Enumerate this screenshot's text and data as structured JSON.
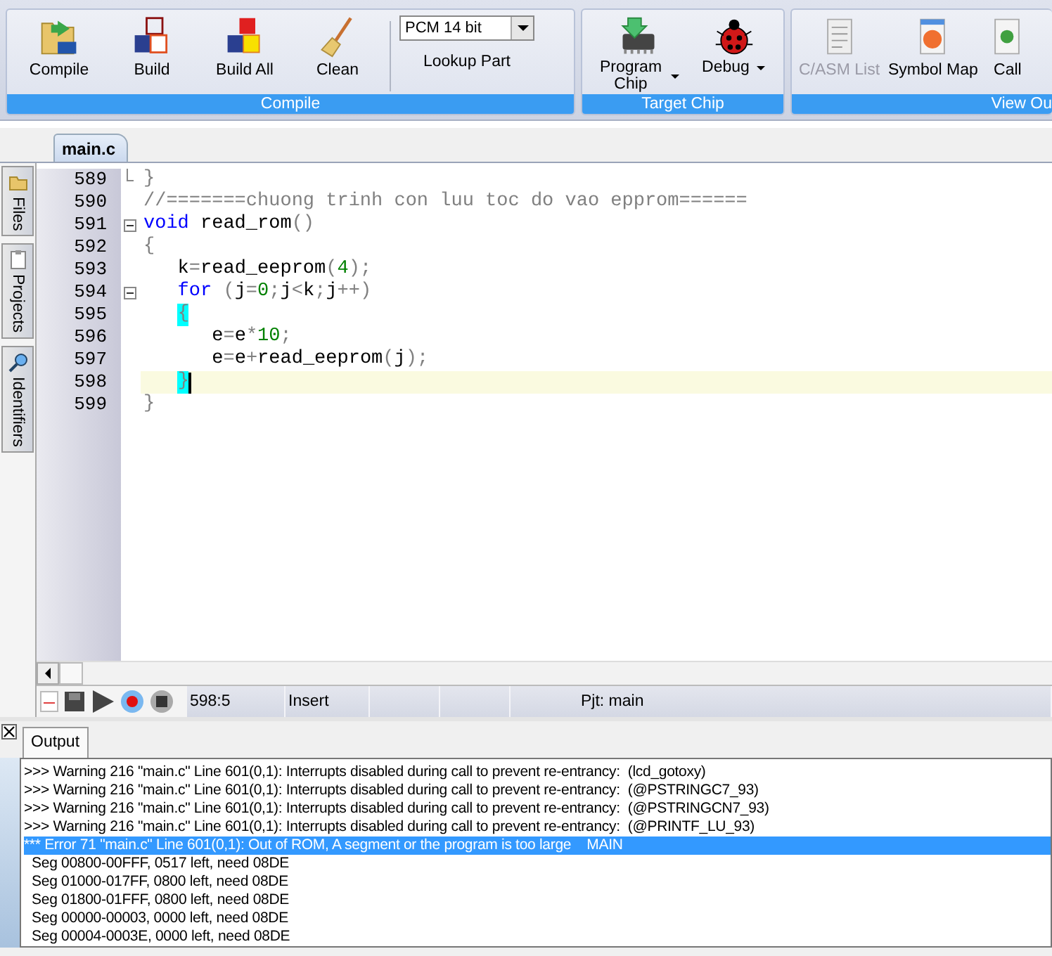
{
  "ribbon": {
    "groups": [
      {
        "label": "Compile",
        "buttons": [
          {
            "label": "Compile",
            "disabled": false,
            "dropdown": false
          },
          {
            "label": "Build",
            "disabled": false,
            "dropdown": false
          },
          {
            "label": "Build All",
            "disabled": false,
            "dropdown": false
          },
          {
            "label": "Clean",
            "disabled": false,
            "dropdown": false
          }
        ],
        "part_selector": {
          "value": "PCM 14 bit",
          "button": "Lookup Part"
        }
      },
      {
        "label": "Target Chip",
        "buttons": [
          {
            "label": "Program Chip",
            "disabled": false,
            "dropdown": true
          },
          {
            "label": "Debug",
            "disabled": false,
            "dropdown": true
          }
        ]
      },
      {
        "label": "View Ou",
        "buttons": [
          {
            "label": "C/ASM List",
            "disabled": true,
            "dropdown": false
          },
          {
            "label": "Symbol Map",
            "disabled": false,
            "dropdown": false
          },
          {
            "label": "Call",
            "disabled": false,
            "dropdown": false
          }
        ]
      }
    ]
  },
  "editor": {
    "tab": {
      "label": "main.c",
      "selected": true
    },
    "side_tabs": [
      {
        "label": "Files"
      },
      {
        "label": "Projects"
      },
      {
        "label": "Identifiers"
      }
    ],
    "lines": [
      {
        "number": "589",
        "foldable": false,
        "fold_end": true,
        "current": false,
        "tokens": [
          {
            "text": "}",
            "kind": "op"
          }
        ]
      },
      {
        "number": "590",
        "foldable": false,
        "fold_end": false,
        "current": false,
        "tokens": [
          {
            "text": "//=======chuong trinh con luu toc do vao epprom======",
            "kind": "cm"
          }
        ]
      },
      {
        "number": "591",
        "foldable": true,
        "fold_end": false,
        "current": false,
        "tokens": [
          {
            "text": "void",
            "kind": "kw"
          },
          {
            "text": " read_rom",
            "kind": "id"
          },
          {
            "text": "()",
            "kind": "op"
          }
        ]
      },
      {
        "number": "592",
        "foldable": false,
        "fold_end": false,
        "current": false,
        "tokens": [
          {
            "text": "{",
            "kind": "op"
          }
        ]
      },
      {
        "number": "593",
        "foldable": false,
        "fold_end": false,
        "current": false,
        "tokens": [
          {
            "text": "   k",
            "kind": "id"
          },
          {
            "text": "=",
            "kind": "op"
          },
          {
            "text": "read_eeprom",
            "kind": "id"
          },
          {
            "text": "(",
            "kind": "op"
          },
          {
            "text": "4",
            "kind": "num"
          },
          {
            "text": ");",
            "kind": "op"
          }
        ]
      },
      {
        "number": "594",
        "foldable": true,
        "fold_end": false,
        "current": false,
        "tokens": [
          {
            "text": "   for",
            "kind": "kw"
          },
          {
            "text": " (",
            "kind": "op"
          },
          {
            "text": "j",
            "kind": "id"
          },
          {
            "text": "=",
            "kind": "op"
          },
          {
            "text": "0",
            "kind": "num"
          },
          {
            "text": ";",
            "kind": "op"
          },
          {
            "text": "j",
            "kind": "id"
          },
          {
            "text": "<",
            "kind": "op"
          },
          {
            "text": "k",
            "kind": "id"
          },
          {
            "text": ";",
            "kind": "op"
          },
          {
            "text": "j",
            "kind": "id"
          },
          {
            "text": "++)",
            "kind": "op"
          }
        ]
      },
      {
        "number": "595",
        "foldable": false,
        "fold_end": false,
        "current": false,
        "tokens": [
          {
            "text": "   {",
            "kind": "match"
          }
        ]
      },
      {
        "number": "596",
        "foldable": false,
        "fold_end": false,
        "current": false,
        "tokens": [
          {
            "text": "      e",
            "kind": "id"
          },
          {
            "text": "=",
            "kind": "op"
          },
          {
            "text": "e",
            "kind": "id"
          },
          {
            "text": "*",
            "kind": "op"
          },
          {
            "text": "10",
            "kind": "num"
          },
          {
            "text": ";",
            "kind": "op"
          }
        ]
      },
      {
        "number": "597",
        "foldable": false,
        "fold_end": false,
        "current": false,
        "tokens": [
          {
            "text": "      e",
            "kind": "id"
          },
          {
            "text": "=",
            "kind": "op"
          },
          {
            "text": "e",
            "kind": "id"
          },
          {
            "text": "+",
            "kind": "op"
          },
          {
            "text": "read_eeprom",
            "kind": "id"
          },
          {
            "text": "(",
            "kind": "op"
          },
          {
            "text": "j",
            "kind": "id"
          },
          {
            "text": ");",
            "kind": "op"
          }
        ]
      },
      {
        "number": "598",
        "foldable": false,
        "fold_end": false,
        "current": true,
        "tokens": [
          {
            "text": "   }",
            "kind": "match"
          }
        ]
      },
      {
        "number": "599",
        "foldable": false,
        "fold_end": false,
        "current": false,
        "tokens": [
          {
            "text": "}",
            "kind": "op"
          }
        ]
      }
    ]
  },
  "status_bar": {
    "position": "598:5",
    "mode": "Insert",
    "project": "Pjt: main"
  },
  "output": {
    "tab": {
      "label": "Output",
      "selected": true
    },
    "rows": [
      {
        "text": ">>> Warning 216 \"main.c\" Line 601(0,1): Interrupts disabled during call to prevent re-entrancy:  (lcd_gotoxy)",
        "selected": false
      },
      {
        "text": ">>> Warning 216 \"main.c\" Line 601(0,1): Interrupts disabled during call to prevent re-entrancy:  (@PSTRINGC7_93)",
        "selected": false
      },
      {
        "text": ">>> Warning 216 \"main.c\" Line 601(0,1): Interrupts disabled during call to prevent re-entrancy:  (@PSTRINGCN7_93)",
        "selected": false
      },
      {
        "text": ">>> Warning 216 \"main.c\" Line 601(0,1): Interrupts disabled during call to prevent re-entrancy:  (@PRINTF_LU_93)",
        "selected": false
      },
      {
        "text": "*** Error 71 \"main.c\" Line 601(0,1): Out of ROM, A segment or the program is too large    MAIN",
        "selected": true
      },
      {
        "text": "  Seg 00800-00FFF, 0517 left, need 08DE",
        "selected": false
      },
      {
        "text": "  Seg 01000-017FF, 0800 left, need 08DE",
        "selected": false
      },
      {
        "text": "  Seg 01800-01FFF, 0800 left, need 08DE",
        "selected": false
      },
      {
        "text": "  Seg 00000-00003, 0000 left, need 08DE",
        "selected": false
      },
      {
        "text": "  Seg 00004-0003E, 0000 left, need 08DE",
        "selected": false
      }
    ]
  }
}
